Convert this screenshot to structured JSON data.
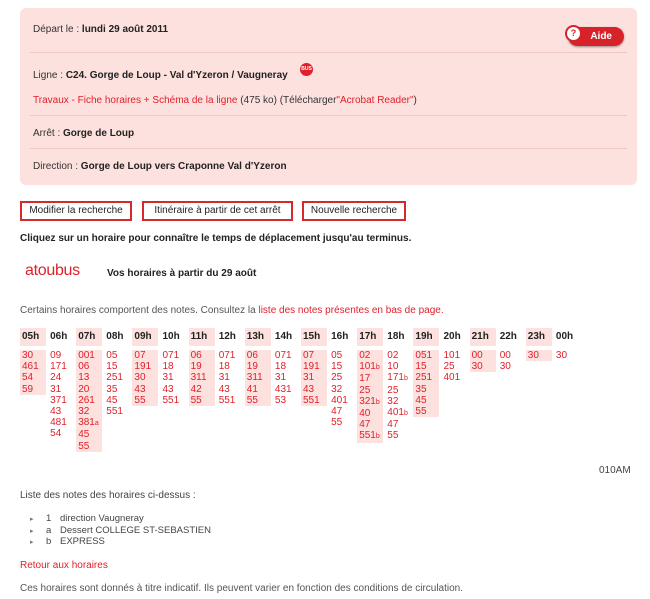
{
  "info": {
    "depart_label": "Départ le :",
    "depart_value": "lundi 29 août 2011",
    "help_label": "Aide",
    "help_q": "?",
    "ligne_label": "Ligne :",
    "ligne_value": "C24. Gorge de Loup - Val d'Yzeron / Vaugneray",
    "bus_badge": "BUS",
    "travaux_link": "Travaux - Fiche horaires + Schéma de la ligne",
    "travaux_size": "(475 ko)",
    "telecharger_prefix": "(Télécharger",
    "acrobat_link": "\"Acrobat Reader\"",
    "telecharger_suffix": ")",
    "arret_label": "Arrêt :",
    "arret_value": "Gorge de Loup",
    "direction_label": "Direction :",
    "direction_value": "Gorge de Loup vers Craponne Val d'Yzeron"
  },
  "buttons": {
    "modifier": "Modifier la recherche",
    "itineraire": "Itinéraire à partir de cet arrêt",
    "nouvelle": "Nouvelle recherche"
  },
  "hint": "Cliquez sur un horaire pour connaître le temps de déplacement jusqu'au terminus.",
  "logo": {
    "part1": "atou",
    "part2": "bus"
  },
  "horaires_title": "Vos horaires à partir du 29 août",
  "notes_line": {
    "prefix": "Certains horaires comportent des notes. Consultez la",
    "link": "liste des notes présentes en bas de page."
  },
  "schedule": [
    {
      "hour": "05h",
      "mins": [
        "30",
        "461",
        "54",
        "59"
      ]
    },
    {
      "hour": "06h",
      "mins": [
        "09",
        "171",
        "24",
        "31",
        "371",
        "43",
        "481",
        "54"
      ]
    },
    {
      "hour": "07h",
      "mins": [
        "001",
        "06",
        "13",
        "20",
        "261",
        "32",
        "381a",
        "45",
        "55"
      ]
    },
    {
      "hour": "08h",
      "mins": [
        "05",
        "15",
        "251",
        "35",
        "45",
        "551"
      ]
    },
    {
      "hour": "09h",
      "mins": [
        "07",
        "191",
        "30",
        "43",
        "55"
      ]
    },
    {
      "hour": "10h",
      "mins": [
        "071",
        "18",
        "31",
        "43",
        "551"
      ]
    },
    {
      "hour": "11h",
      "mins": [
        "06",
        "19",
        "311",
        "42",
        "55"
      ]
    },
    {
      "hour": "12h",
      "mins": [
        "071",
        "18",
        "31",
        "43",
        "551"
      ]
    },
    {
      "hour": "13h",
      "mins": [
        "06",
        "19",
        "311",
        "41",
        "55"
      ]
    },
    {
      "hour": "14h",
      "mins": [
        "071",
        "18",
        "31",
        "431",
        "53"
      ]
    },
    {
      "hour": "15h",
      "mins": [
        "07",
        "191",
        "31",
        "43",
        "551"
      ]
    },
    {
      "hour": "16h",
      "mins": [
        "05",
        "15",
        "25",
        "32",
        "401",
        "47",
        "55"
      ]
    },
    {
      "hour": "17h",
      "mins": [
        "02",
        "101b",
        "17",
        "25",
        "321b",
        "40",
        "47",
        "551b"
      ]
    },
    {
      "hour": "18h",
      "mins": [
        "02",
        "10",
        "171b",
        "25",
        "32",
        "401b",
        "47",
        "55"
      ]
    },
    {
      "hour": "19h",
      "mins": [
        "051",
        "15",
        "251",
        "35",
        "45",
        "55"
      ]
    },
    {
      "hour": "20h",
      "mins": [
        "101",
        "25",
        "401"
      ]
    },
    {
      "hour": "21h",
      "mins": [
        "00",
        "30"
      ]
    },
    {
      "hour": "22h",
      "mins": [
        "00",
        "30"
      ]
    },
    {
      "hour": "23h",
      "mins": [
        "30"
      ]
    },
    {
      "hour": "00h",
      "mins": [
        "30"
      ]
    }
  ],
  "o10_text": "010AM",
  "notes_title": "Liste des notes des horaires ci-dessus :",
  "notes": [
    {
      "key": "1",
      "text": "direction Vaugneray"
    },
    {
      "key": "a",
      "text": "Dessert COLLEGE ST-SEBASTIEN"
    },
    {
      "key": "b",
      "text": "EXPRESS"
    }
  ],
  "back_link": "Retour aux horaires",
  "footer": "Ces horaires sont donnés à titre indicatif. Ils peuvent varier en fonction des conditions de circulation.",
  "colors": {
    "accent": "#e0202b",
    "panel": "#fce1df"
  }
}
